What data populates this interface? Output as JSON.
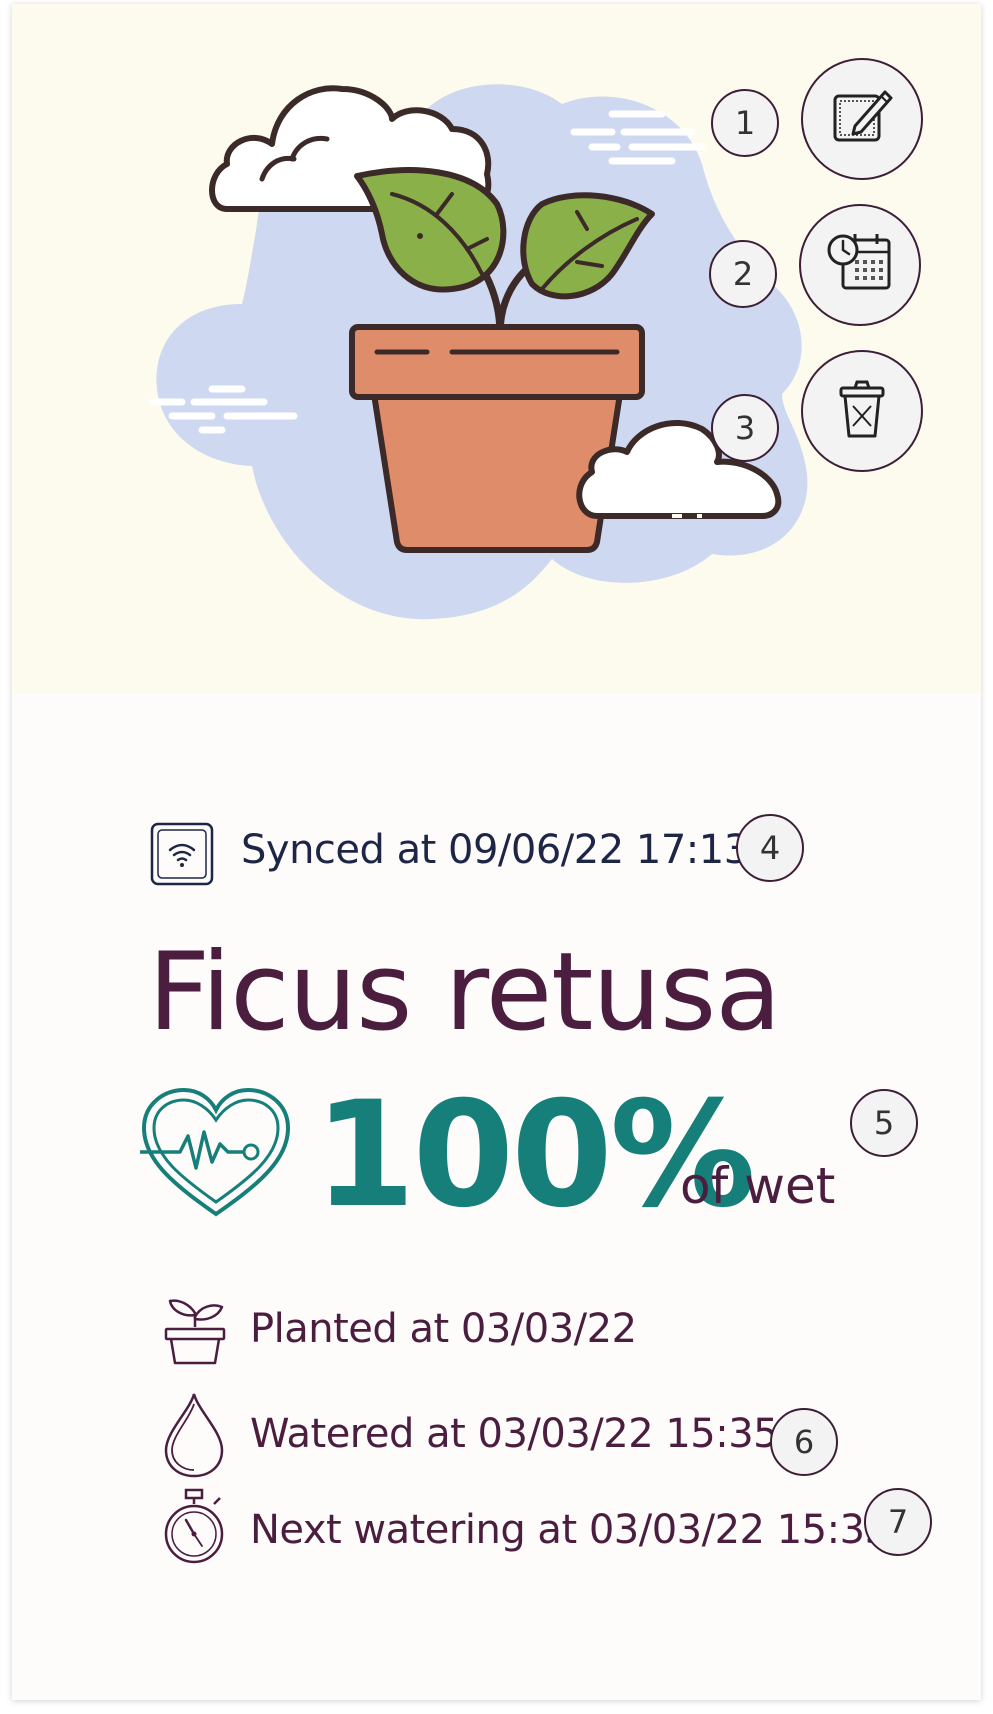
{
  "actions": [
    {
      "number": "1",
      "icon": "edit-icon",
      "label": "edit"
    },
    {
      "number": "2",
      "icon": "schedule-calendar-icon",
      "label": "schedule"
    },
    {
      "number": "3",
      "icon": "trash-icon",
      "label": "delete"
    }
  ],
  "sync": {
    "icon": "wifi-device-icon",
    "text": "Synced at 09/06/22 17:13",
    "badge": "4"
  },
  "plant": {
    "name": "Ficus retusa"
  },
  "humidity": {
    "icon": "heart-pulse-icon",
    "value": "100%",
    "unit": "of wet",
    "badge": "5"
  },
  "details": {
    "planted": {
      "icon": "plant-pot-icon",
      "text": "Planted at 03/03/22"
    },
    "watered": {
      "icon": "water-drop-icon",
      "text": "Watered at 03/03/22 15:35",
      "badge": "6"
    },
    "next": {
      "icon": "stopwatch-icon",
      "text": "Next watering at 03/03/22 15:35",
      "badge": "7"
    }
  },
  "colors": {
    "hero_bg": "#fcfbee",
    "cloud": "#cfd8f1",
    "pot": "#de8c69",
    "leaf": "#8ab04a",
    "outline": "#3c2a28",
    "accent": "#167f7a",
    "text": "#4b1d3f"
  }
}
